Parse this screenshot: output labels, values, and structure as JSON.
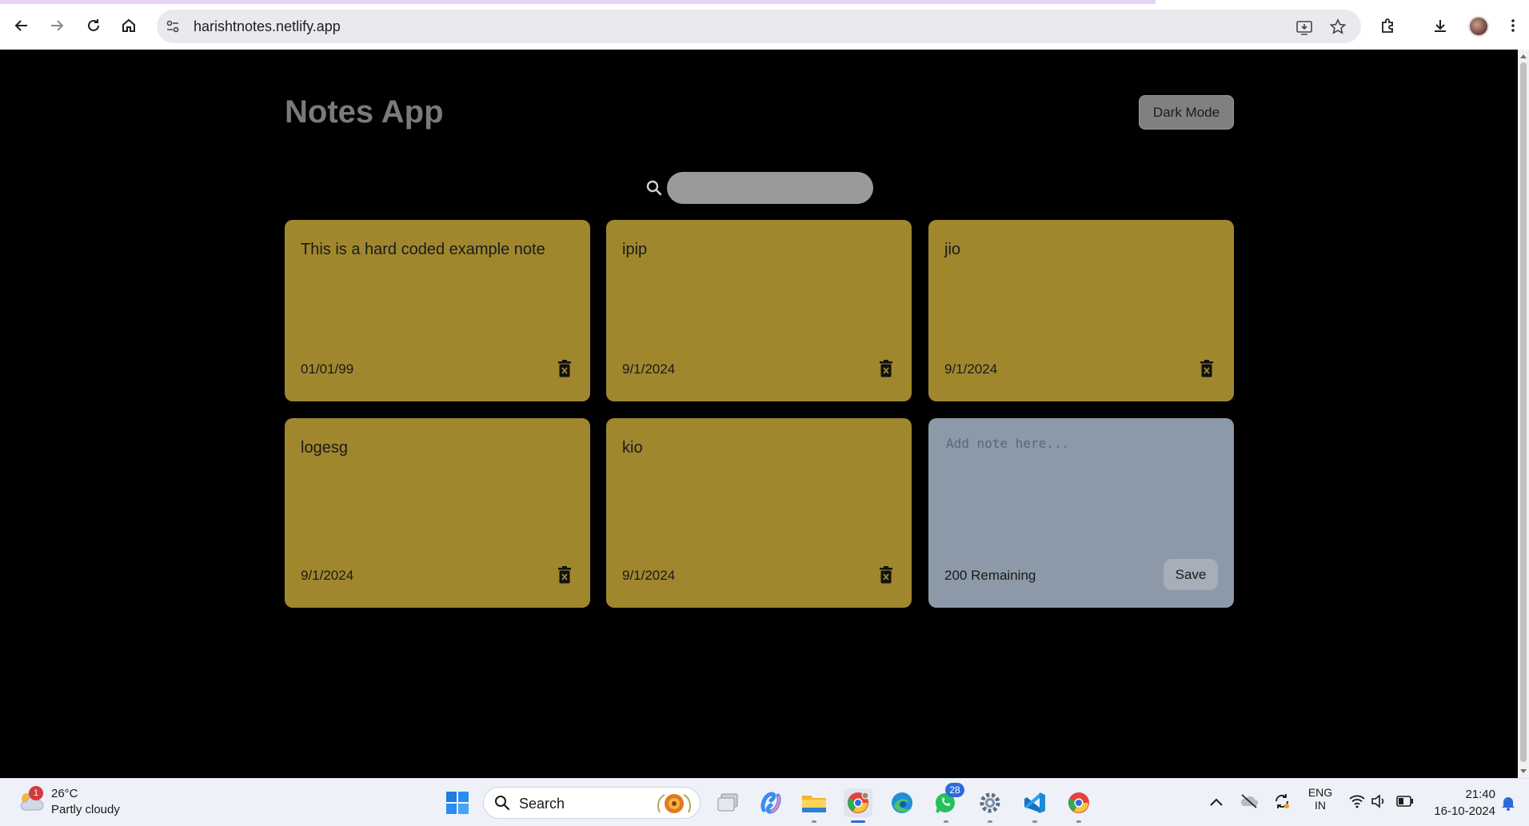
{
  "browser": {
    "url": "harishtnotes.netlify.app"
  },
  "app": {
    "title": "Notes App",
    "dark_mode_label": "Dark Mode",
    "search_placeholder": ""
  },
  "notes": [
    {
      "text": "This is a hard coded example note",
      "date": "01/01/99"
    },
    {
      "text": "ipip",
      "date": "9/1/2024"
    },
    {
      "text": "jio",
      "date": "9/1/2024"
    },
    {
      "text": "logesg",
      "date": "9/1/2024"
    },
    {
      "text": "kio",
      "date": "9/1/2024"
    }
  ],
  "new_note": {
    "placeholder": "Add note here...",
    "remaining": "200 Remaining",
    "save_label": "Save"
  },
  "colors": {
    "note_bg": "#a0872e",
    "new_note_bg": "#8c99a8",
    "page_bg": "#000000"
  },
  "taskbar": {
    "weather_temp": "26°C",
    "weather_condition": "Partly cloudy",
    "weather_badge": "1",
    "search_label": "Search",
    "whatsapp_badge": "28",
    "lang": "ENG",
    "region": "IN",
    "time": "21:40",
    "date": "16-10-2024"
  }
}
